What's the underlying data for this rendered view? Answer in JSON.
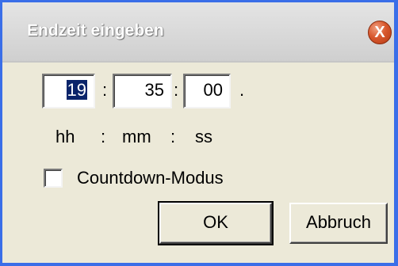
{
  "window": {
    "title": "Endzeit eingeben",
    "close_glyph": "X"
  },
  "time": {
    "hours": "19",
    "minutes": "35",
    "seconds": "00",
    "separator": ":",
    "trailing": "."
  },
  "format_hint": {
    "hh": "hh",
    "mm": "mm",
    "ss": "ss",
    "separator": ":"
  },
  "countdown": {
    "label": "Countdown-Modus",
    "checked": false
  },
  "buttons": {
    "ok": "OK",
    "cancel": "Abbruch"
  },
  "colors": {
    "frame_border": "#3a6ee8",
    "dialog_bg": "#ece9d8",
    "selection_bg": "#0a246a",
    "close_red": "#d8582e"
  }
}
